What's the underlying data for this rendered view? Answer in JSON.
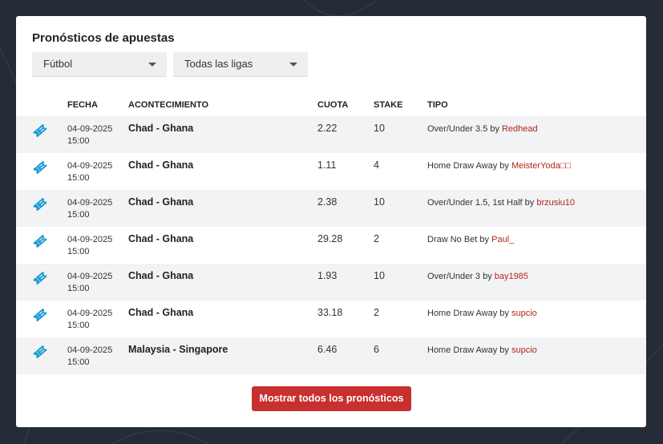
{
  "widget": {
    "title": "Pronósticos de apuestas",
    "sport_select": "Fútbol",
    "league_select": "Todas las ligas",
    "show_all_button": "Mostrar todos los pronósticos",
    "row_icon": "ticket-icon"
  },
  "table": {
    "headers": {
      "date": "FECHA",
      "event": "ACONTECIMIENTO",
      "odds": "CUOTA",
      "stake": "STAKE",
      "type": "TIPO"
    },
    "rows": [
      {
        "date": "04-09-2025",
        "time": "15:00",
        "event": "Chad - Ghana",
        "odds": "2.22",
        "stake": "10",
        "tipo": "Over/Under 3.5 by ",
        "user": "Redhead"
      },
      {
        "date": "04-09-2025",
        "time": "15:00",
        "event": "Chad - Ghana",
        "odds": "1.11",
        "stake": "4",
        "tipo": "Home Draw Away by ",
        "user": "MeisterYoda□□"
      },
      {
        "date": "04-09-2025",
        "time": "15:00",
        "event": "Chad - Ghana",
        "odds": "2.38",
        "stake": "10",
        "tipo": "Over/Under 1.5, 1st Half by ",
        "user": "brzusiu10"
      },
      {
        "date": "04-09-2025",
        "time": "15:00",
        "event": "Chad - Ghana",
        "odds": "29.28",
        "stake": "2",
        "tipo": "Draw No Bet by ",
        "user": "Paul_"
      },
      {
        "date": "04-09-2025",
        "time": "15:00",
        "event": "Chad - Ghana",
        "odds": "1.93",
        "stake": "10",
        "tipo": "Over/Under 3 by ",
        "user": "bay1985"
      },
      {
        "date": "04-09-2025",
        "time": "15:00",
        "event": "Chad - Ghana",
        "odds": "33.18",
        "stake": "2",
        "tipo": "Home Draw Away by ",
        "user": "supcio"
      },
      {
        "date": "04-09-2025",
        "time": "15:00",
        "event": "Malaysia - Singapore",
        "odds": "6.46",
        "stake": "6",
        "tipo": "Home Draw Away by ",
        "user": "supcio"
      }
    ]
  },
  "colors": {
    "accent_red": "#c7302e",
    "icon_blue": "#1a9ad6",
    "background": "#252b36"
  }
}
